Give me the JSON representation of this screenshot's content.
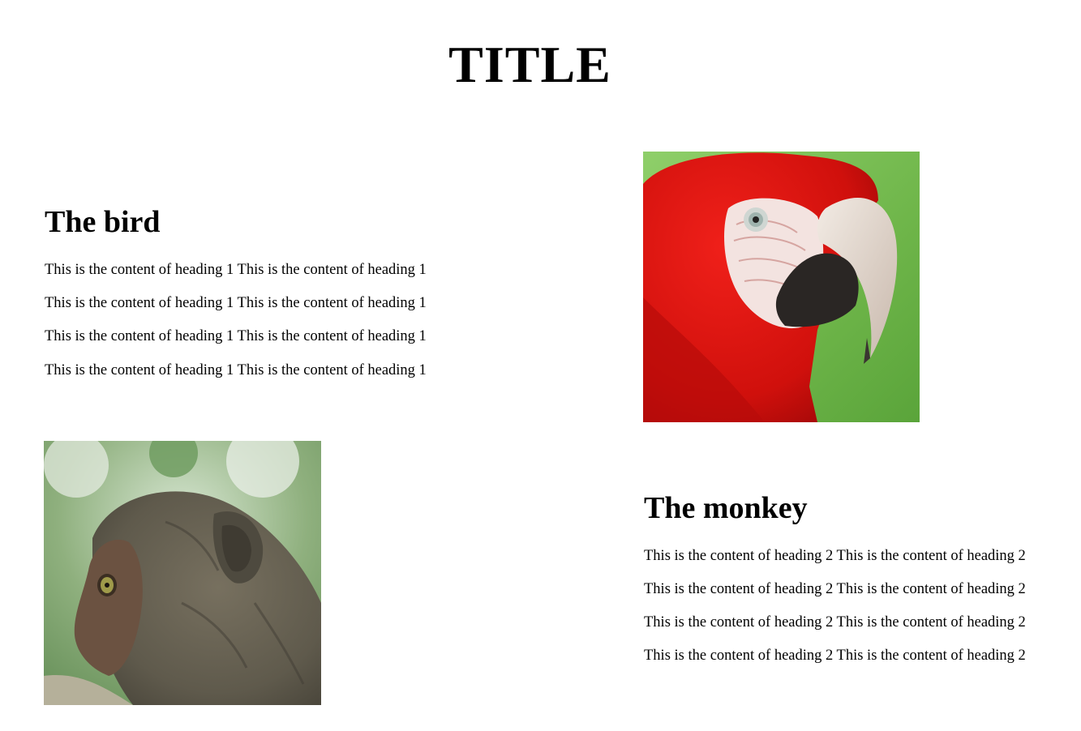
{
  "page": {
    "title": "TITLE"
  },
  "bird_section": {
    "heading": "The bird",
    "paragraphs": [
      "This is the content of heading 1 This is the content of heading 1",
      "This is the content of heading 1 This is the content of heading 1",
      "This is the content of heading 1 This is the content of heading 1",
      "This is the content of heading 1 This is the content of heading 1"
    ],
    "image": "parrot-photo"
  },
  "monkey_section": {
    "heading": "The monkey",
    "paragraphs": [
      "This is the content of heading 2 This is the content of heading 2",
      "This is the content of heading 2 This is the content of heading 2",
      "This is the content of heading 2 This is the content of heading 2",
      "This is the content of heading 2 This is the content of heading 2"
    ],
    "image": "monkey-photo"
  }
}
